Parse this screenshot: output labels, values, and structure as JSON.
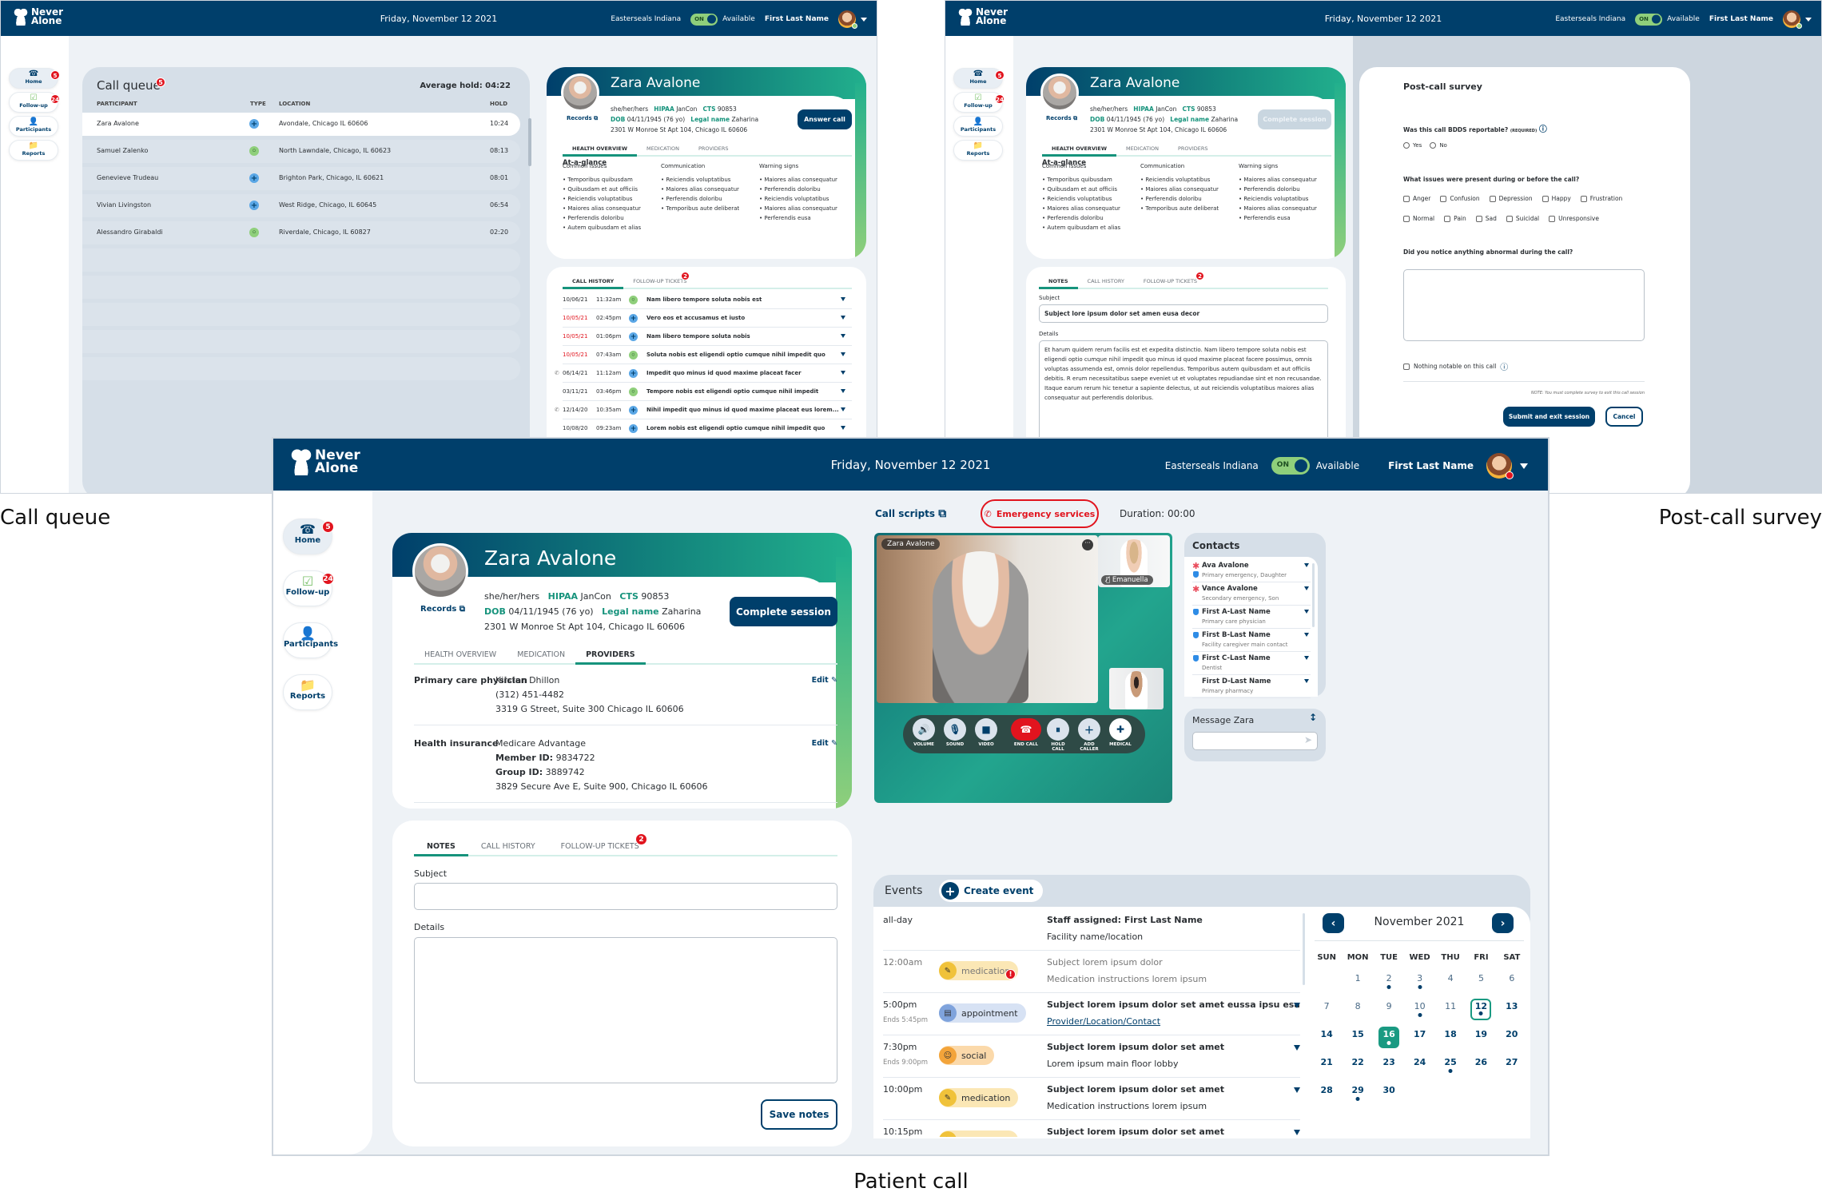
{
  "captions": {
    "call_queue": "Call queue",
    "post_call_survey": "Post-call survey",
    "patient_call": "Patient call"
  },
  "header": {
    "logo_line1": "Never",
    "logo_line2": "Alone",
    "date": "Friday, November 12 2021",
    "org": "Easterseals Indiana",
    "toggle_label": "ON",
    "status": "Available",
    "user_name": "First Last Name"
  },
  "nav": {
    "items": [
      {
        "label": "Home",
        "icon": "phone-heart-icon",
        "badge": "5"
      },
      {
        "label": "Follow-up",
        "icon": "checklist-icon",
        "badge": "24"
      },
      {
        "label": "Participants",
        "icon": "participants-icon",
        "badge": ""
      },
      {
        "label": "Reports",
        "icon": "folder-phone-icon",
        "badge": ""
      }
    ]
  },
  "colors": {
    "navy": "#003f6b",
    "teal": "#16937c",
    "red": "#e1141e",
    "green": "#8fcf7b"
  },
  "queue": {
    "title": "Call queue",
    "badge": "5",
    "avg_hold": "Average hold: 04:22",
    "columns": [
      "PARTICIPANT",
      "TYPE",
      "LOCATION",
      "HOLD"
    ],
    "rows": [
      {
        "participant": "Zara Avalone",
        "type": "medical",
        "location": "Avondale, Chicago IL 60606",
        "hold": "10:24"
      },
      {
        "participant": "Samuel Zalenko",
        "type": "social",
        "location": "North Lawndale, Chicago, IL 60623",
        "hold": "08:13"
      },
      {
        "participant": "Genevieve Trudeau",
        "type": "medical",
        "location": "Brighton Park, Chicago, IL 60621",
        "hold": "08:01"
      },
      {
        "participant": "Vivian Livingston",
        "type": "medical",
        "location": "West Ridge, Chicago, IL 60645",
        "hold": "06:54"
      },
      {
        "participant": "Alessandro Girabaldi",
        "type": "social",
        "location": "Riverdale, Chicago, IL 60827",
        "hold": "02:20"
      }
    ]
  },
  "patient": {
    "name": "Zara Avalone",
    "records": "Records",
    "pronouns": "she/her/hers",
    "hipaa_label": "HIPAA",
    "hipaa_value": "JanCon",
    "cts_label": "CTS",
    "cts_value": "90853",
    "dob_label": "DOB",
    "dob_value": "04/11/1945 (76 yo)",
    "legal_label": "Legal name",
    "legal_value": "Zaharina",
    "address": "2301 W Monroe St Apt 104, Chicago IL 60606",
    "answer_call": "Answer call",
    "complete_session": "Complete session",
    "tabs": [
      "HEALTH OVERVIEW",
      "MEDICATION",
      "PROVIDERS"
    ],
    "at_a_glance": "At-a-glance",
    "common_issues": {
      "title": "Common issues",
      "items": [
        "Temporibus quibusdam",
        "Quibusdam et aut officiis",
        "Reiciendis voluptatibus",
        "Maiores alias consequatur",
        "Perferendis doloribu",
        "Autem quibusdam et alias"
      ]
    },
    "communication": {
      "title": "Communication",
      "items": [
        "Reiciendis voluptatibus",
        "Maiores alias consequatur",
        "Perferendis doloribu",
        "Temporibus aute deliberat"
      ]
    },
    "warning_signs": {
      "title": "Warning signs",
      "items": [
        "Maiores alias consequatur",
        "Perferendis doloribu",
        "Reiciendis voluptatibus",
        "Maiores alias consequatur",
        "Perferendis eusa"
      ]
    },
    "providers": [
      {
        "label": "Primary care physician",
        "lines": [
          "Kirsten Dhillon",
          "(312) 451-4482",
          "3319 G Street, Suite 300 Chicago IL 60606"
        ],
        "edit": "Edit"
      },
      {
        "label": "Health insurance",
        "lines": [
          "Medicare Advantage",
          "Member ID: 9834722",
          "Group ID: 3889742",
          "3829 Secure Ave E, Suite 900, Chicago IL 60606"
        ],
        "edit": "Edit"
      }
    ]
  },
  "lower_tabs": {
    "notes": "NOTES",
    "call_history": "CALL HISTORY",
    "follow_up": "FOLLOW-UP TICKETS",
    "follow_up_badge": "2"
  },
  "call_history": [
    {
      "date": "10/06/21",
      "time": "11:32am",
      "type": "social",
      "subject": "Nam libero tempore soluta nobis est",
      "red": false,
      "phone": false
    },
    {
      "date": "10/05/21",
      "time": "02:45pm",
      "type": "medical",
      "subject": "Vero eos et accusamus et iusto",
      "red": true,
      "phone": false
    },
    {
      "date": "10/05/21",
      "time": "01:06pm",
      "type": "medical",
      "subject": "Nam libero tempore soluta nobis",
      "red": true,
      "phone": false
    },
    {
      "date": "10/05/21",
      "time": "07:43am",
      "type": "social",
      "subject": "Soluta nobis est eligendi optio cumque nihil impedit quo",
      "red": true,
      "phone": false
    },
    {
      "date": "06/14/21",
      "time": "11:12am",
      "type": "medical",
      "subject": "Impedit quo minus id quod maxime placeat facer",
      "red": false,
      "phone": true
    },
    {
      "date": "03/11/21",
      "time": "03:46pm",
      "type": "social",
      "subject": "Tempore nobis est eligendi optio cumque nihil impedit",
      "red": false,
      "phone": false
    },
    {
      "date": "12/14/20",
      "time": "10:35am",
      "type": "medical",
      "subject": "Nihil impedit quo minus id quod maxime placeat eus lorem...",
      "red": false,
      "phone": true
    },
    {
      "date": "10/08/20",
      "time": "09:23am",
      "type": "medical",
      "subject": "Lorem nobis est eligendi optio cumque nihil impedit quo",
      "red": false,
      "phone": false
    }
  ],
  "notes_filled": {
    "subject_label": "Subject",
    "subject_value": "Subject lore ipsum dolor set amen eusa decor",
    "details_label": "Details",
    "details_value": "Et harum quidem rerum facilis est et expedita distinctio. Nam libero tempore soluta nobis est eligendi optio cumque nihil impedit quo minus id quod maxime placeat facere possimus, omnis voluptas assumenda est, omnis dolor repellendus. Temporibus autem quibusdam et aut officiis debitis. R erum necessitatibus saepe eveniet ut et voluptates repudiandae sint et non recusandae. Itaque earum rerum hic tenetur a sapiente delectus, ut aut reiciendis voluptatibus maiores alias consequatur aut perferendis doloribus."
  },
  "notes_empty": {
    "subject_label": "Subject",
    "subject_value": "",
    "details_label": "Details",
    "details_value": "",
    "save": "Save notes"
  },
  "survey": {
    "title": "Post-call survey",
    "q1": "Was this call BDDS reportable?",
    "q1_required": "(REQUIRED)",
    "q1_options": [
      "Yes",
      "No"
    ],
    "q2": "What issues were present during or before the call?",
    "q2_row1": [
      "Anger",
      "Confusion",
      "Depression",
      "Happy",
      "Frustration"
    ],
    "q2_row2": [
      "Normal",
      "Pain",
      "Sad",
      "Suicidal",
      "Unresponsive"
    ],
    "q3": "Did you notice anything abnormal during the call?",
    "q3_value": "",
    "nothing_notable": "Nothing notable on this call",
    "note": "NOTE: You must complete survey to exit this call session",
    "submit": "Submit and exit session",
    "cancel": "Cancel"
  },
  "call": {
    "call_scripts": "Call scripts",
    "emergency": "Emergency services",
    "duration": "Duration: 00:00",
    "main_tile_name": "Zara Avalone",
    "staff_tile_name": "Emanuella",
    "controls": [
      {
        "label": "VOLUME",
        "icon": "volume-icon"
      },
      {
        "label": "SOUND",
        "icon": "microphone-icon"
      },
      {
        "label": "VIDEO",
        "icon": "video-camera-icon"
      },
      {
        "label": "END CALL",
        "icon": "end-call-icon"
      },
      {
        "label": "HOLD CALL",
        "icon": "hold-call-icon"
      },
      {
        "label": "ADD CALLER",
        "icon": "add-caller-icon"
      },
      {
        "label": "MEDICAL",
        "icon": "medical-call-icon"
      }
    ]
  },
  "contacts": {
    "title": "Contacts",
    "items": [
      {
        "name": "Ava Avalone",
        "role": "Primary emergency, Daughter",
        "emergency": true,
        "verified": true
      },
      {
        "name": "Vance Avalone",
        "role": "Secondary emergency, Son",
        "emergency": true,
        "verified": false
      },
      {
        "name": "First A-Last Name",
        "role": "Primary care physician",
        "emergency": false,
        "verified": true
      },
      {
        "name": "First B-Last Name",
        "role": "Facility caregiver main contact",
        "emergency": false,
        "verified": true
      },
      {
        "name": "First C-Last Name",
        "role": "Dentist",
        "emergency": false,
        "verified": true
      },
      {
        "name": "First D-Last Name",
        "role": "Primary pharmacy",
        "emergency": false,
        "verified": false
      }
    ]
  },
  "message": {
    "title": "Message Zara",
    "placeholder": ""
  },
  "events": {
    "title": "Events",
    "create": "Create event",
    "items": [
      {
        "time": "all-day",
        "ends": "",
        "category": "staff",
        "title": "Staff assigned: First Last Name",
        "sub": "Facility name/location",
        "muted": false,
        "alert": false,
        "expand": false,
        "link": false
      },
      {
        "time": "12:00am",
        "ends": "",
        "category": "medication",
        "title": "Subject lorem ipsum dolor",
        "sub": "Medication instructions lorem ipsum",
        "muted": true,
        "alert": true,
        "expand": false,
        "link": false
      },
      {
        "time": "5:00pm",
        "ends": "Ends 5:45pm",
        "category": "appointment",
        "title": "Subject lorem ipsum dolor set amet eussa ipsu esa",
        "sub": "Provider/Location/Contact",
        "muted": false,
        "alert": false,
        "expand": true,
        "link": true
      },
      {
        "time": "7:30pm",
        "ends": "Ends 9:00pm",
        "category": "social",
        "title": "Subject lorem ipsum dolor set amet",
        "sub": "Lorem ipsum main floor lobby",
        "muted": false,
        "alert": false,
        "expand": true,
        "link": false
      },
      {
        "time": "10:00pm",
        "ends": "",
        "category": "medication",
        "title": "Subject lorem ipsum dolor set amet",
        "sub": "Medication instructions lorem ipsum",
        "muted": false,
        "alert": false,
        "expand": true,
        "link": false
      },
      {
        "time": "10:15pm",
        "ends": "",
        "category": "medication",
        "title": "Subject lorem ipsum dolor set amet",
        "sub": "",
        "muted": false,
        "alert": false,
        "expand": true,
        "link": false
      }
    ]
  },
  "calendar": {
    "month": "November 2021",
    "weekdays": [
      "SUN",
      "MON",
      "TUE",
      "WED",
      "THU",
      "FRI",
      "SAT"
    ],
    "first_weekday": 1,
    "days": 30,
    "today": 12,
    "selected": 16,
    "event_days": [
      2,
      3,
      10,
      12,
      16,
      25,
      29
    ]
  }
}
